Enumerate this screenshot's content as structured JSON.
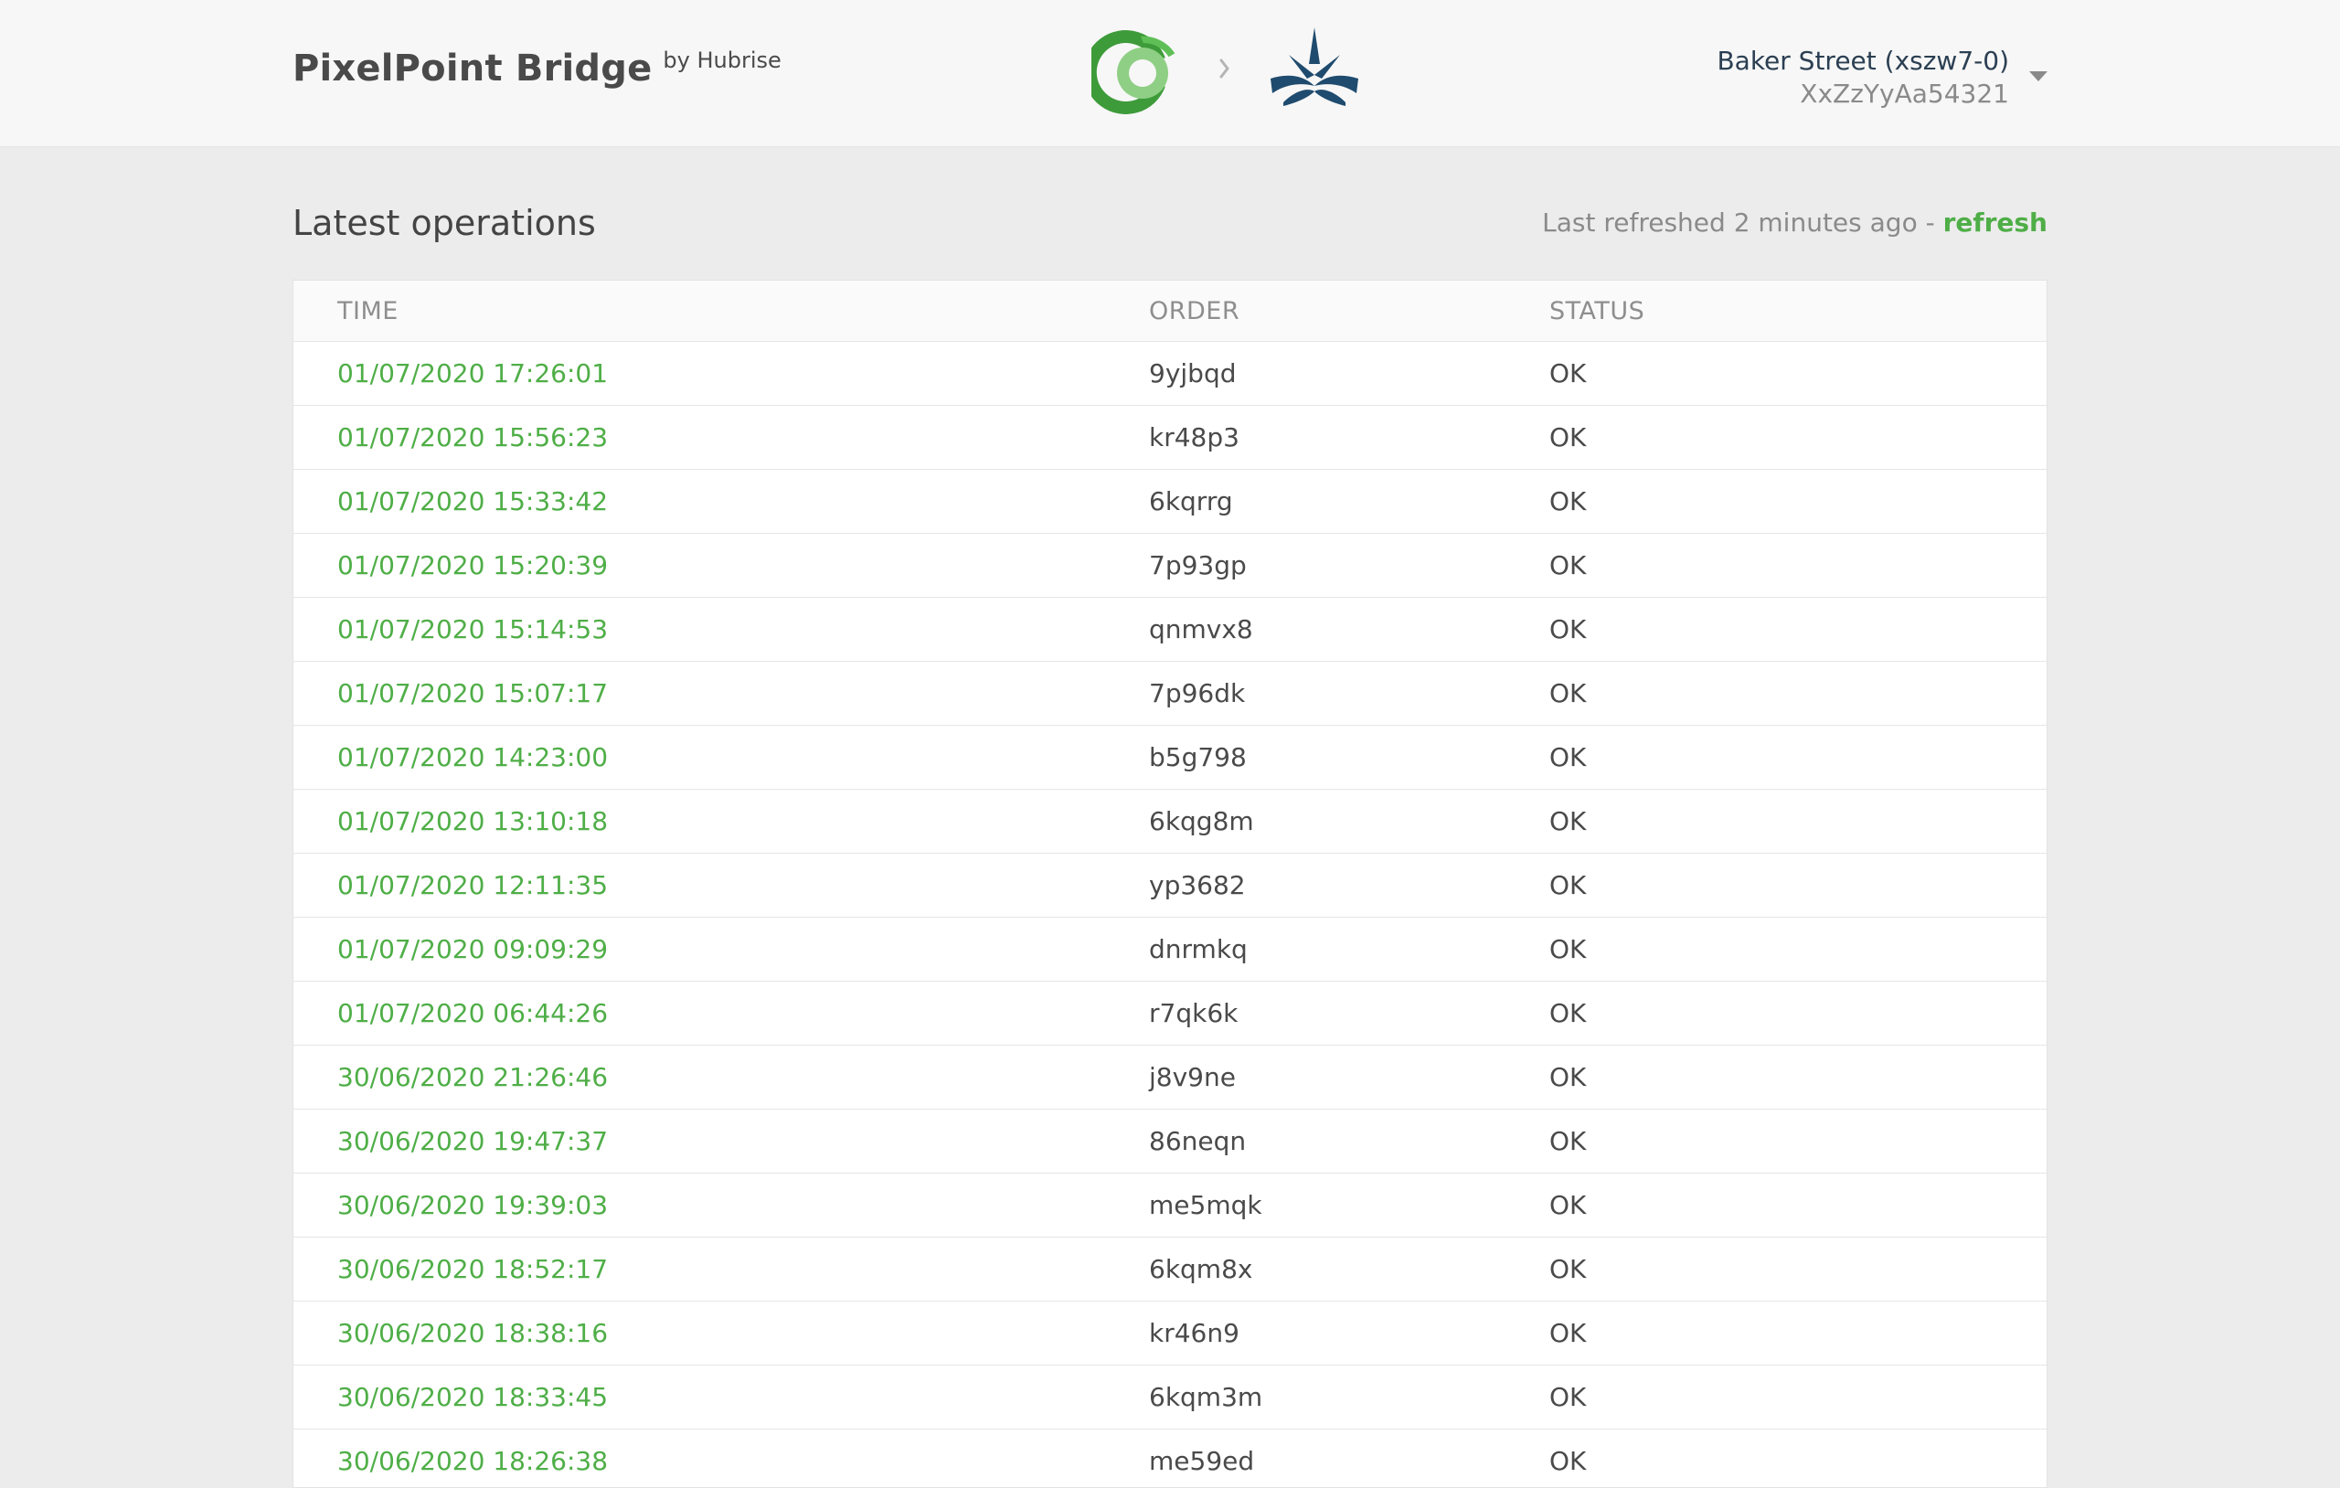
{
  "header": {
    "app_name": "PixelPoint Bridge",
    "by_label": "by Hubrise",
    "account_name": "Baker Street (xszw7-0)",
    "account_id": "XxZzYyAa54321",
    "brand_colors": {
      "hubrise_green": "#4fae47",
      "pixelpoint_navy": "#1f4b6e"
    },
    "icons": [
      "hubrise-logo-icon",
      "chevron-right-icon",
      "pixelpoint-logo-icon",
      "caret-down-icon"
    ]
  },
  "operations": {
    "title": "Latest operations",
    "refresh_prefix": "Last refreshed 2 minutes ago - ",
    "refresh_label": "refresh",
    "columns": {
      "time": "TIME",
      "order": "ORDER",
      "status": "STATUS"
    },
    "rows": [
      {
        "time": "01/07/2020 17:26:01",
        "order": "9yjbqd",
        "status": "OK"
      },
      {
        "time": "01/07/2020 15:56:23",
        "order": "kr48p3",
        "status": "OK"
      },
      {
        "time": "01/07/2020 15:33:42",
        "order": "6kqrrg",
        "status": "OK"
      },
      {
        "time": "01/07/2020 15:20:39",
        "order": "7p93gp",
        "status": "OK"
      },
      {
        "time": "01/07/2020 15:14:53",
        "order": "qnmvx8",
        "status": "OK"
      },
      {
        "time": "01/07/2020 15:07:17",
        "order": "7p96dk",
        "status": "OK"
      },
      {
        "time": "01/07/2020 14:23:00",
        "order": "b5g798",
        "status": "OK"
      },
      {
        "time": "01/07/2020 13:10:18",
        "order": "6kqg8m",
        "status": "OK"
      },
      {
        "time": "01/07/2020 12:11:35",
        "order": "yp3682",
        "status": "OK"
      },
      {
        "time": "01/07/2020 09:09:29",
        "order": "dnrmkq",
        "status": "OK"
      },
      {
        "time": "01/07/2020 06:44:26",
        "order": "r7qk6k",
        "status": "OK"
      },
      {
        "time": "30/06/2020 21:26:46",
        "order": "j8v9ne",
        "status": "OK"
      },
      {
        "time": "30/06/2020 19:47:37",
        "order": "86neqn",
        "status": "OK"
      },
      {
        "time": "30/06/2020 19:39:03",
        "order": "me5mqk",
        "status": "OK"
      },
      {
        "time": "30/06/2020 18:52:17",
        "order": "6kqm8x",
        "status": "OK"
      },
      {
        "time": "30/06/2020 18:38:16",
        "order": "kr46n9",
        "status": "OK"
      },
      {
        "time": "30/06/2020 18:33:45",
        "order": "6kqm3m",
        "status": "OK"
      },
      {
        "time": "30/06/2020 18:26:38",
        "order": "me59ed",
        "status": "OK"
      }
    ]
  }
}
